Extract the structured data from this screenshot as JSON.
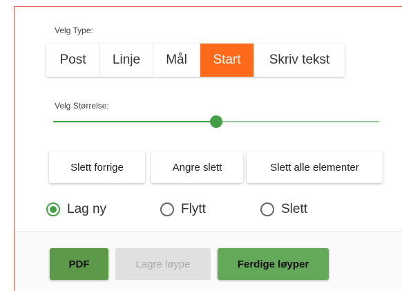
{
  "type_section": {
    "label": "Velg Type:",
    "options": [
      "Post",
      "Linje",
      "Mål",
      "Start",
      "Skriv tekst"
    ],
    "selected": "Start"
  },
  "size_section": {
    "label": "Velg Størrelse:",
    "value_fraction": 0.5
  },
  "actions": {
    "undo_last": "Slett forrige",
    "redo_delete": "Angre slett",
    "delete_all": "Slett alle elementer"
  },
  "mode": {
    "options": [
      "Lag ny",
      "Flytt",
      "Slett"
    ],
    "selected": "Lag ny"
  },
  "bottom": {
    "pdf": "PDF",
    "save": "Lagre løype",
    "finished": "Ferdige løyper"
  },
  "colors": {
    "accent_orange": "#ff6a1a",
    "accent_green": "#43a047",
    "pdf_green": "#5c9a4a",
    "finished_green": "#64a85a",
    "frame_red": "#e06058"
  }
}
